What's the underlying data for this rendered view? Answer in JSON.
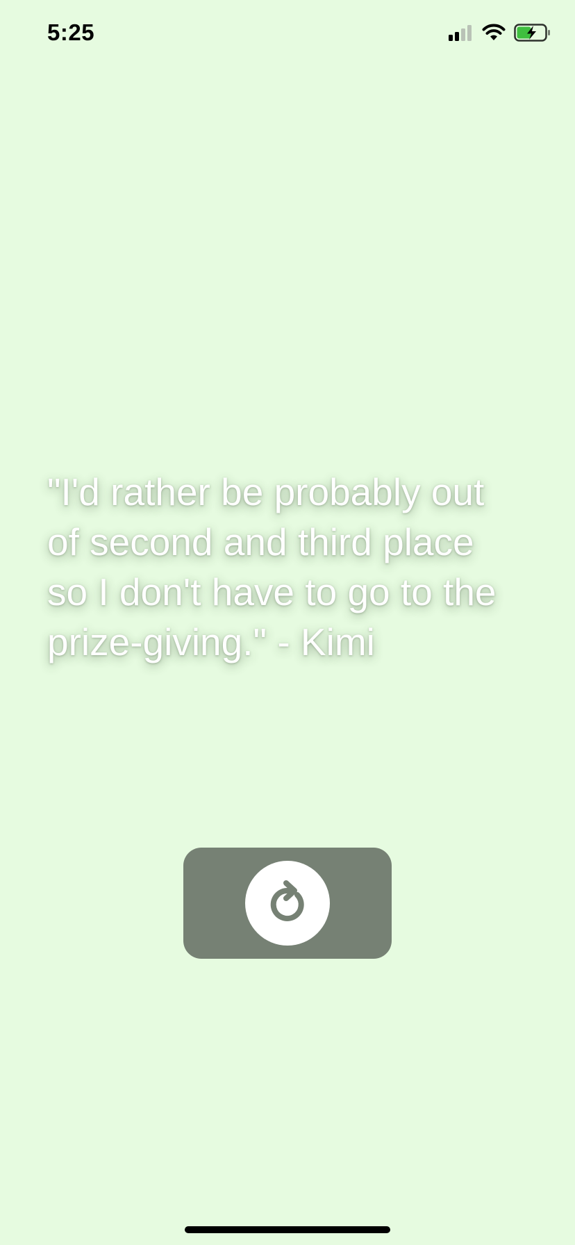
{
  "status_bar": {
    "time": "5:25",
    "icons": [
      "cellular-signal-icon",
      "wifi-icon",
      "battery-charging-icon"
    ]
  },
  "quote": {
    "text": "\"I'd rather be probably out\nof second and third place\nso I don't have to go to the\nprize-giving.\" - Kimi"
  },
  "refresh_button": {
    "icon": "refresh-icon"
  },
  "colors": {
    "background": "#e6fbe0",
    "button": "#768174",
    "quote_text": "#ffffff",
    "battery_green": "#3fbf3f"
  }
}
